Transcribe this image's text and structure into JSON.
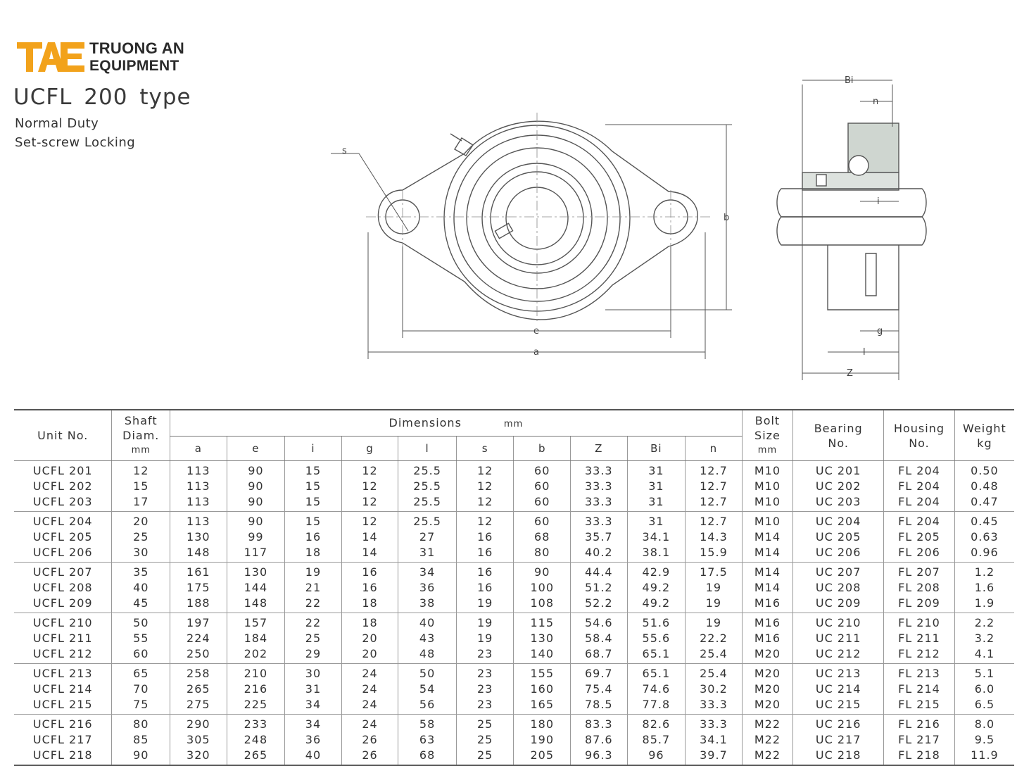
{
  "brand": {
    "line1": "TRUONG AN",
    "line2": "EQUIPMENT",
    "logo_text": "TAE",
    "logo_color": "#f2a21b"
  },
  "header": {
    "title": "UCFL  200  type",
    "subtitle1": "Normal Duty",
    "subtitle2": "Set-screw Locking"
  },
  "drawing_labels": {
    "s": "s",
    "b": "b",
    "e": "e",
    "a": "a",
    "Bi": "Bi",
    "n": "n",
    "i": "i",
    "g": "g",
    "l": "l",
    "Z": "Z"
  },
  "table": {
    "headers": {
      "unit": "Unit No.",
      "shaft1": "Shaft",
      "shaft2": "Diam.",
      "shaft3": "mm",
      "dimensions": "Dimensions",
      "dim_unit": "mm",
      "bolt1": "Bolt",
      "bolt2": "Size",
      "bolt3": "mm",
      "bearing1": "Bearing",
      "bearing2": "No.",
      "housing1": "Housing",
      "housing2": "No.",
      "weight1": "Weight",
      "weight2": "kg",
      "cols": [
        "a",
        "e",
        "i",
        "g",
        "l",
        "s",
        "b",
        "Z",
        "Bi",
        "n"
      ]
    },
    "groups": [
      {
        "unit": [
          "UCFL 201",
          "UCFL 202",
          "UCFL 203"
        ],
        "shaft": [
          "12",
          "15",
          "17"
        ],
        "a": [
          "113",
          "113",
          "113"
        ],
        "e": [
          "90",
          "90",
          "90"
        ],
        "i": [
          "15",
          "15",
          "15"
        ],
        "g": [
          "12",
          "12",
          "12"
        ],
        "l": [
          "25.5",
          "25.5",
          "25.5"
        ],
        "s": [
          "12",
          "12",
          "12"
        ],
        "b": [
          "60",
          "60",
          "60"
        ],
        "Z": [
          "33.3",
          "33.3",
          "33.3"
        ],
        "Bi": [
          "31",
          "31",
          "31"
        ],
        "n": [
          "12.7",
          "12.7",
          "12.7"
        ],
        "bolt": [
          "M10",
          "M10",
          "M10"
        ],
        "bearing": [
          "UC 201",
          "UC 202",
          "UC 203"
        ],
        "housing": [
          "FL 204",
          "FL 204",
          "FL 204"
        ],
        "weight": [
          "0.50",
          "0.48",
          "0.47"
        ]
      },
      {
        "unit": [
          "UCFL 204",
          "UCFL 205",
          "UCFL 206"
        ],
        "shaft": [
          "20",
          "25",
          "30"
        ],
        "a": [
          "113",
          "130",
          "148"
        ],
        "e": [
          "90",
          "99",
          "117"
        ],
        "i": [
          "15",
          "16",
          "18"
        ],
        "g": [
          "12",
          "14",
          "14"
        ],
        "l": [
          "25.5",
          "27",
          "31"
        ],
        "s": [
          "12",
          "16",
          "16"
        ],
        "b": [
          "60",
          "68",
          "80"
        ],
        "Z": [
          "33.3",
          "35.7",
          "40.2"
        ],
        "Bi": [
          "31",
          "34.1",
          "38.1"
        ],
        "n": [
          "12.7",
          "14.3",
          "15.9"
        ],
        "bolt": [
          "M10",
          "M14",
          "M14"
        ],
        "bearing": [
          "UC 204",
          "UC 205",
          "UC 206"
        ],
        "housing": [
          "FL 204",
          "FL 205",
          "FL 206"
        ],
        "weight": [
          "0.45",
          "0.63",
          "0.96"
        ]
      },
      {
        "unit": [
          "UCFL 207",
          "UCFL 208",
          "UCFL 209"
        ],
        "shaft": [
          "35",
          "40",
          "45"
        ],
        "a": [
          "161",
          "175",
          "188"
        ],
        "e": [
          "130",
          "144",
          "148"
        ],
        "i": [
          "19",
          "21",
          "22"
        ],
        "g": [
          "16",
          "16",
          "18"
        ],
        "l": [
          "34",
          "36",
          "38"
        ],
        "s": [
          "16",
          "16",
          "19"
        ],
        "b": [
          "90",
          "100",
          "108"
        ],
        "Z": [
          "44.4",
          "51.2",
          "52.2"
        ],
        "Bi": [
          "42.9",
          "49.2",
          "49.2"
        ],
        "n": [
          "17.5",
          "19",
          "19"
        ],
        "bolt": [
          "M14",
          "M14",
          "M16"
        ],
        "bearing": [
          "UC 207",
          "UC 208",
          "UC 209"
        ],
        "housing": [
          "FL 207",
          "FL 208",
          "FL 209"
        ],
        "weight": [
          "1.2",
          "1.6",
          "1.9"
        ]
      },
      {
        "unit": [
          "UCFL 210",
          "UCFL 211",
          "UCFL 212"
        ],
        "shaft": [
          "50",
          "55",
          "60"
        ],
        "a": [
          "197",
          "224",
          "250"
        ],
        "e": [
          "157",
          "184",
          "202"
        ],
        "i": [
          "22",
          "25",
          "29"
        ],
        "g": [
          "18",
          "20",
          "20"
        ],
        "l": [
          "40",
          "43",
          "48"
        ],
        "s": [
          "19",
          "19",
          "23"
        ],
        "b": [
          "115",
          "130",
          "140"
        ],
        "Z": [
          "54.6",
          "58.4",
          "68.7"
        ],
        "Bi": [
          "51.6",
          "55.6",
          "65.1"
        ],
        "n": [
          "19",
          "22.2",
          "25.4"
        ],
        "bolt": [
          "M16",
          "M16",
          "M20"
        ],
        "bearing": [
          "UC 210",
          "UC 211",
          "UC 212"
        ],
        "housing": [
          "FL 210",
          "FL 211",
          "FL 212"
        ],
        "weight": [
          "2.2",
          "3.2",
          "4.1"
        ]
      },
      {
        "unit": [
          "UCFL 213",
          "UCFL 214",
          "UCFL 215"
        ],
        "shaft": [
          "65",
          "70",
          "75"
        ],
        "a": [
          "258",
          "265",
          "275"
        ],
        "e": [
          "210",
          "216",
          "225"
        ],
        "i": [
          "30",
          "31",
          "34"
        ],
        "g": [
          "24",
          "24",
          "24"
        ],
        "l": [
          "50",
          "54",
          "56"
        ],
        "s": [
          "23",
          "23",
          "23"
        ],
        "b": [
          "155",
          "160",
          "165"
        ],
        "Z": [
          "69.7",
          "75.4",
          "78.5"
        ],
        "Bi": [
          "65.1",
          "74.6",
          "77.8"
        ],
        "n": [
          "25.4",
          "30.2",
          "33.3"
        ],
        "bolt": [
          "M20",
          "M20",
          "M20"
        ],
        "bearing": [
          "UC 213",
          "UC 214",
          "UC 215"
        ],
        "housing": [
          "FL 213",
          "FL 214",
          "FL 215"
        ],
        "weight": [
          "5.1",
          "6.0",
          "6.5"
        ]
      },
      {
        "unit": [
          "UCFL 216",
          "UCFL 217",
          "UCFL 218"
        ],
        "shaft": [
          "80",
          "85",
          "90"
        ],
        "a": [
          "290",
          "305",
          "320"
        ],
        "e": [
          "233",
          "248",
          "265"
        ],
        "i": [
          "34",
          "36",
          "40"
        ],
        "g": [
          "24",
          "26",
          "26"
        ],
        "l": [
          "58",
          "63",
          "68"
        ],
        "s": [
          "25",
          "25",
          "25"
        ],
        "b": [
          "180",
          "190",
          "205"
        ],
        "Z": [
          "83.3",
          "87.6",
          "96.3"
        ],
        "Bi": [
          "82.6",
          "85.7",
          "96"
        ],
        "n": [
          "33.3",
          "34.1",
          "39.7"
        ],
        "bolt": [
          "M22",
          "M22",
          "M22"
        ],
        "bearing": [
          "UC 216",
          "UC 217",
          "UC 218"
        ],
        "housing": [
          "FL 216",
          "FL 217",
          "FL 218"
        ],
        "weight": [
          "8.0",
          "9.5",
          "11.9"
        ]
      }
    ]
  }
}
